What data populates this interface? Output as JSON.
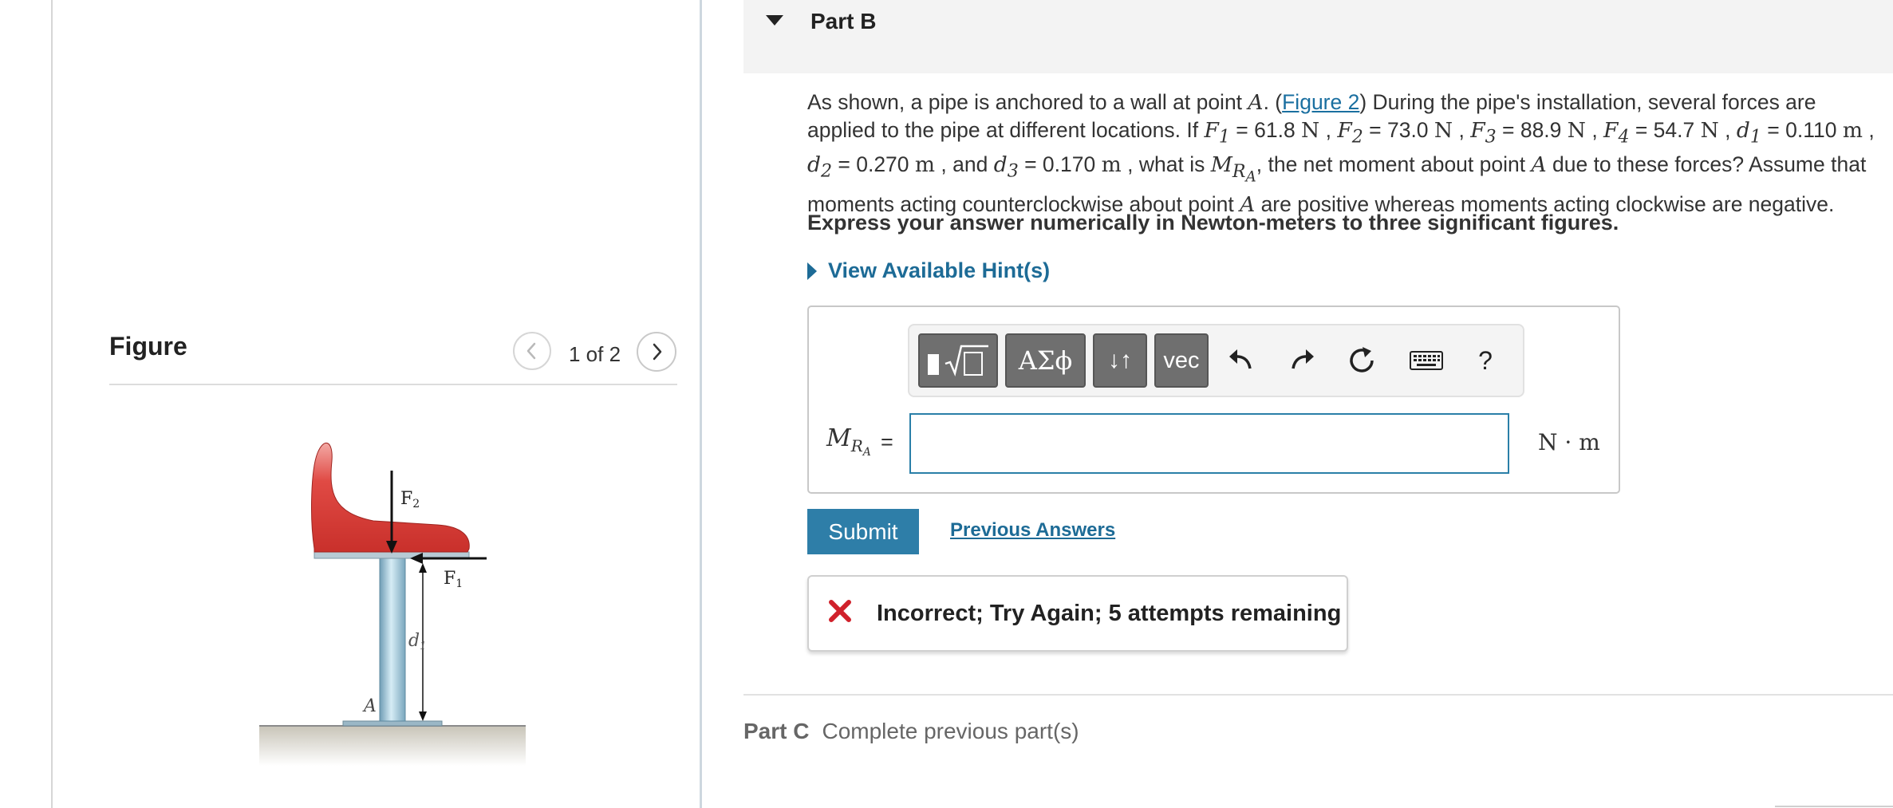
{
  "figure": {
    "title": "Figure",
    "counter": "1 of 2",
    "labels": {
      "f2": "F",
      "f2_sub": "2",
      "f1": "F",
      "f1_sub": "1",
      "d1": "d",
      "d1_sub": "1",
      "a": "A"
    }
  },
  "part_b": {
    "title": "Part B",
    "question": {
      "t1": "As shown, a pipe is anchored to a wall at point ",
      "pointA": "A",
      "t2": ". (",
      "link": "Figure 2",
      "t3": ")  During the pipe's installation, several forces are applied to the pipe at different locations. If ",
      "F1": "F",
      "F1sub": "1",
      "F1val": " = 61.8 ",
      "N": "N",
      "F2": "F",
      "F2sub": "2",
      "F2val": " = 73.0 ",
      "F3": "F",
      "F3sub": "3",
      "F3val": " = 88.9 ",
      "F4": "F",
      "F4sub": "4",
      "F4val": " = 54.7 ",
      "d1": "d",
      "d1sub": "1",
      "d1val": " = 0.110 ",
      "m": "m",
      "d2": "d",
      "d2sub": "2",
      "d2val": " = 0.270 ",
      "and": " , and ",
      "d3": "d",
      "d3sub": "3",
      "d3val": " = 0.170 ",
      "whatis": " , what is ",
      "M": "M",
      "Msub": "R",
      "Msubsub": "A",
      "t4": ", the net moment about point ",
      "t5": " due to these forces? Assume that moments acting counterclockwise about point ",
      "t6": " are positive whereas moments acting clockwise are negative.",
      "comma": " , "
    },
    "instruction": "Express your answer numerically in Newton-meters to three significant figures.",
    "hint_label": "View Available Hint(s)",
    "toolbar": {
      "templates_icon": "sqrt-template-icon",
      "greek_label": "ΑΣϕ",
      "arrows_label": "↓↑",
      "vec_label": "vec",
      "help_label": "?"
    },
    "answer": {
      "label_M": "M",
      "label_sub": "R",
      "label_subsub": "A",
      "equals": "=",
      "value": "",
      "unit": "N · m"
    },
    "submit_label": "Submit",
    "previous_answers_label": "Previous Answers",
    "feedback": "Incorrect; Try Again; 5 attempts remaining"
  },
  "part_c": {
    "title": "Part C",
    "note": "Complete previous part(s)"
  },
  "colors": {
    "accent": "#2e7ea8",
    "link": "#1d6b96",
    "error": "#d0212b",
    "toolbar_button": "#6f6f6f",
    "seat_red": "#d93a36",
    "pipe_blue": "#9fc3d6"
  }
}
